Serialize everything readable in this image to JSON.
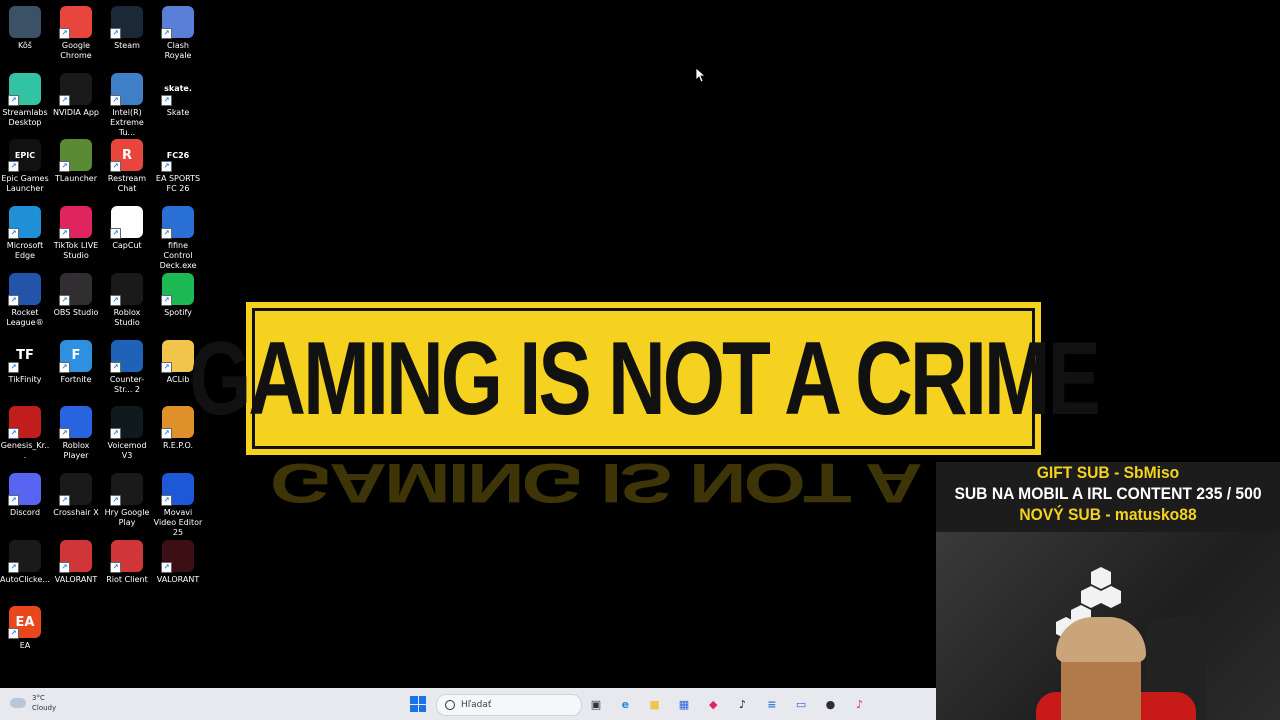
{
  "desktop": {
    "icons": [
      {
        "label": "Kôš",
        "icon": "recycle-bin-icon",
        "color": "#3a5166",
        "glyph": ""
      },
      {
        "label": "Google Chrome",
        "icon": "chrome-icon",
        "color": "#e8453c",
        "glyph": ""
      },
      {
        "label": "Steam",
        "icon": "steam-icon",
        "color": "#1b2838",
        "glyph": ""
      },
      {
        "label": "Clash Royale",
        "icon": "clash-royale-icon",
        "color": "#5a7fd8",
        "glyph": ""
      },
      {
        "label": "Streamlabs Desktop",
        "icon": "streamlabs-icon",
        "color": "#31c3a2",
        "glyph": ""
      },
      {
        "label": "NVIDIA App",
        "icon": "nvidia-icon",
        "color": "#1a1a1a",
        "glyph": ""
      },
      {
        "label": "Intel(R) Extreme Tu...",
        "icon": "intel-xtu-icon",
        "color": "#3f7fc8",
        "glyph": ""
      },
      {
        "label": "Skate",
        "icon": "skate-icon",
        "color": "#000000",
        "glyph": "skate."
      },
      {
        "label": "Epic Games Launcher",
        "icon": "epic-games-icon",
        "color": "#111111",
        "glyph": "EPIC"
      },
      {
        "label": "TLauncher",
        "icon": "tlauncher-icon",
        "color": "#5b8a35",
        "glyph": ""
      },
      {
        "label": "Restream Chat",
        "icon": "restream-icon",
        "color": "#e8453c",
        "glyph": "R"
      },
      {
        "label": "EA SPORTS FC 26",
        "icon": "ea-fc-icon",
        "color": "#000000",
        "glyph": "FC26"
      },
      {
        "label": "Microsoft Edge",
        "icon": "edge-icon",
        "color": "#1f8fd6",
        "glyph": ""
      },
      {
        "label": "TikTok LIVE Studio",
        "icon": "tiktok-live-icon",
        "color": "#e0245e",
        "glyph": ""
      },
      {
        "label": "CapCut",
        "icon": "capcut-icon",
        "color": "#ffffff",
        "glyph": ""
      },
      {
        "label": "fifine Control Deck.exe",
        "icon": "fifine-icon",
        "color": "#2a6fd6",
        "glyph": ""
      },
      {
        "label": "Rocket League®",
        "icon": "rocket-league-icon",
        "color": "#2255aa",
        "glyph": ""
      },
      {
        "label": "OBS Studio",
        "icon": "obs-icon",
        "color": "#302e31",
        "glyph": ""
      },
      {
        "label": "Roblox Studio",
        "icon": "roblox-studio-icon",
        "color": "#1a1a1a",
        "glyph": ""
      },
      {
        "label": "Spotify",
        "icon": "spotify-icon",
        "color": "#1db954",
        "glyph": ""
      },
      {
        "label": "TikFinity",
        "icon": "tikfinity-icon",
        "color": "#000000",
        "glyph": "TF"
      },
      {
        "label": "Fortnite",
        "icon": "fortnite-icon",
        "color": "#2f8fe0",
        "glyph": "F"
      },
      {
        "label": "Counter-Str... 2",
        "icon": "counter-strike-icon",
        "color": "#1e63b8",
        "glyph": ""
      },
      {
        "label": "ACLib",
        "icon": "folder-icon",
        "color": "#f1c44b",
        "glyph": ""
      },
      {
        "label": "Genesis_Kr...",
        "icon": "genesis-icon",
        "color": "#c11d1d",
        "glyph": ""
      },
      {
        "label": "Roblox Player",
        "icon": "roblox-player-icon",
        "color": "#2a63e0",
        "glyph": ""
      },
      {
        "label": "Voicemod V3",
        "icon": "voicemod-icon",
        "color": "#0f1a1f",
        "glyph": ""
      },
      {
        "label": "R.E.P.O.",
        "icon": "repo-icon",
        "color": "#e0902a",
        "glyph": ""
      },
      {
        "label": "Discord",
        "icon": "discord-icon",
        "color": "#5865f2",
        "glyph": ""
      },
      {
        "label": "Crosshair X",
        "icon": "crosshair-x-icon",
        "color": "#1a1a1a",
        "glyph": ""
      },
      {
        "label": "Hry Google Play",
        "icon": "google-play-games-icon",
        "color": "#1a1a1a",
        "glyph": ""
      },
      {
        "label": "Movavi Video Editor 25",
        "icon": "movavi-icon",
        "color": "#1c58d8",
        "glyph": ""
      },
      {
        "label": "AutoClicke...",
        "icon": "autoclicker-icon",
        "color": "#1a1a1a",
        "glyph": ""
      },
      {
        "label": "VALORANT",
        "icon": "riot-valorant-icon",
        "color": "#d13639",
        "glyph": ""
      },
      {
        "label": "Riot Client",
        "icon": "riot-client-icon",
        "color": "#d13639",
        "glyph": ""
      },
      {
        "label": "VALORANT",
        "icon": "valorant-icon",
        "color": "#3c0f14",
        "glyph": ""
      },
      {
        "label": "EA",
        "icon": "ea-icon",
        "color": "#e8471c",
        "glyph": "EA"
      }
    ]
  },
  "wallpaper": {
    "banner_text": "GAMING IS NOT A CRIME",
    "reflection_text": "GAMING IS NOT A CR",
    "banner_color": "#f4d21f"
  },
  "overlay": {
    "line1": "GIFT SUB - SbMiso",
    "line2": "SUB NA MOBIL A IRL CONTENT  235 / 500",
    "line3": "NOVÝ SUB - matusko88"
  },
  "taskbar": {
    "weather_temp": "3°C",
    "weather_text": "Cloudy",
    "search_placeholder": "Hľadať",
    "apps": [
      {
        "icon": "task-view-icon",
        "color": "#333333",
        "glyph": "▣"
      },
      {
        "icon": "edge-taskbar-icon",
        "color": "#1f8fd6",
        "glyph": "e"
      },
      {
        "icon": "file-explorer-icon",
        "color": "#f1c44b",
        "glyph": "■"
      },
      {
        "icon": "store-icon",
        "color": "#2a63e0",
        "glyph": "▦"
      },
      {
        "icon": "app-red-icon",
        "color": "#e0245e",
        "glyph": "◆"
      },
      {
        "icon": "tiktok-icon",
        "color": "#111111",
        "glyph": "♪"
      },
      {
        "icon": "notepad-icon",
        "color": "#3a7bd5",
        "glyph": "≡"
      },
      {
        "icon": "monitor-app-icon",
        "color": "#2a63e0",
        "glyph": "▭"
      },
      {
        "icon": "obs-taskbar-icon",
        "color": "#302e31",
        "glyph": "●"
      },
      {
        "icon": "tiktok-live-taskbar-icon",
        "color": "#e0245e",
        "glyph": "♪"
      }
    ]
  }
}
